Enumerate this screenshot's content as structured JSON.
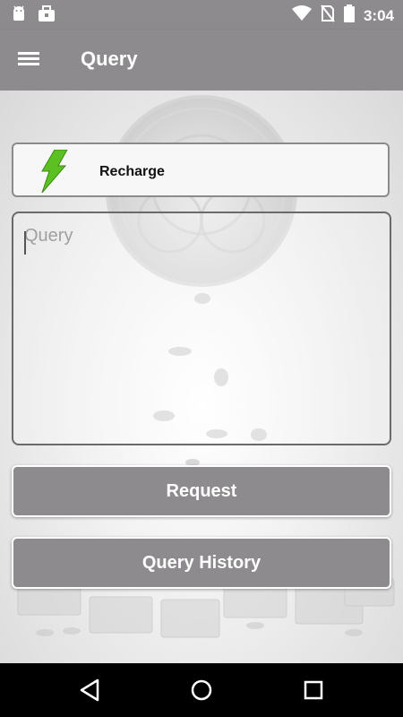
{
  "status_bar": {
    "time": "3:04",
    "icons": [
      "android-icon",
      "briefcase-icon",
      "wifi-icon",
      "no-sim-icon",
      "battery-icon"
    ]
  },
  "app_bar": {
    "title": "Query",
    "menu_icon": "menu-icon"
  },
  "recharge": {
    "label": "Recharge",
    "icon": "lightning-icon",
    "icon_color": "#5cc023"
  },
  "query": {
    "placeholder": "Query",
    "value": ""
  },
  "buttons": {
    "request_label": "Request",
    "history_label": "Query History"
  },
  "nav_bar": {
    "icons": [
      "back-icon",
      "home-icon",
      "recents-icon"
    ]
  },
  "colors": {
    "bar": "#8e8b8e",
    "button": "#8e8b8e",
    "accent_green": "#5cc023"
  }
}
